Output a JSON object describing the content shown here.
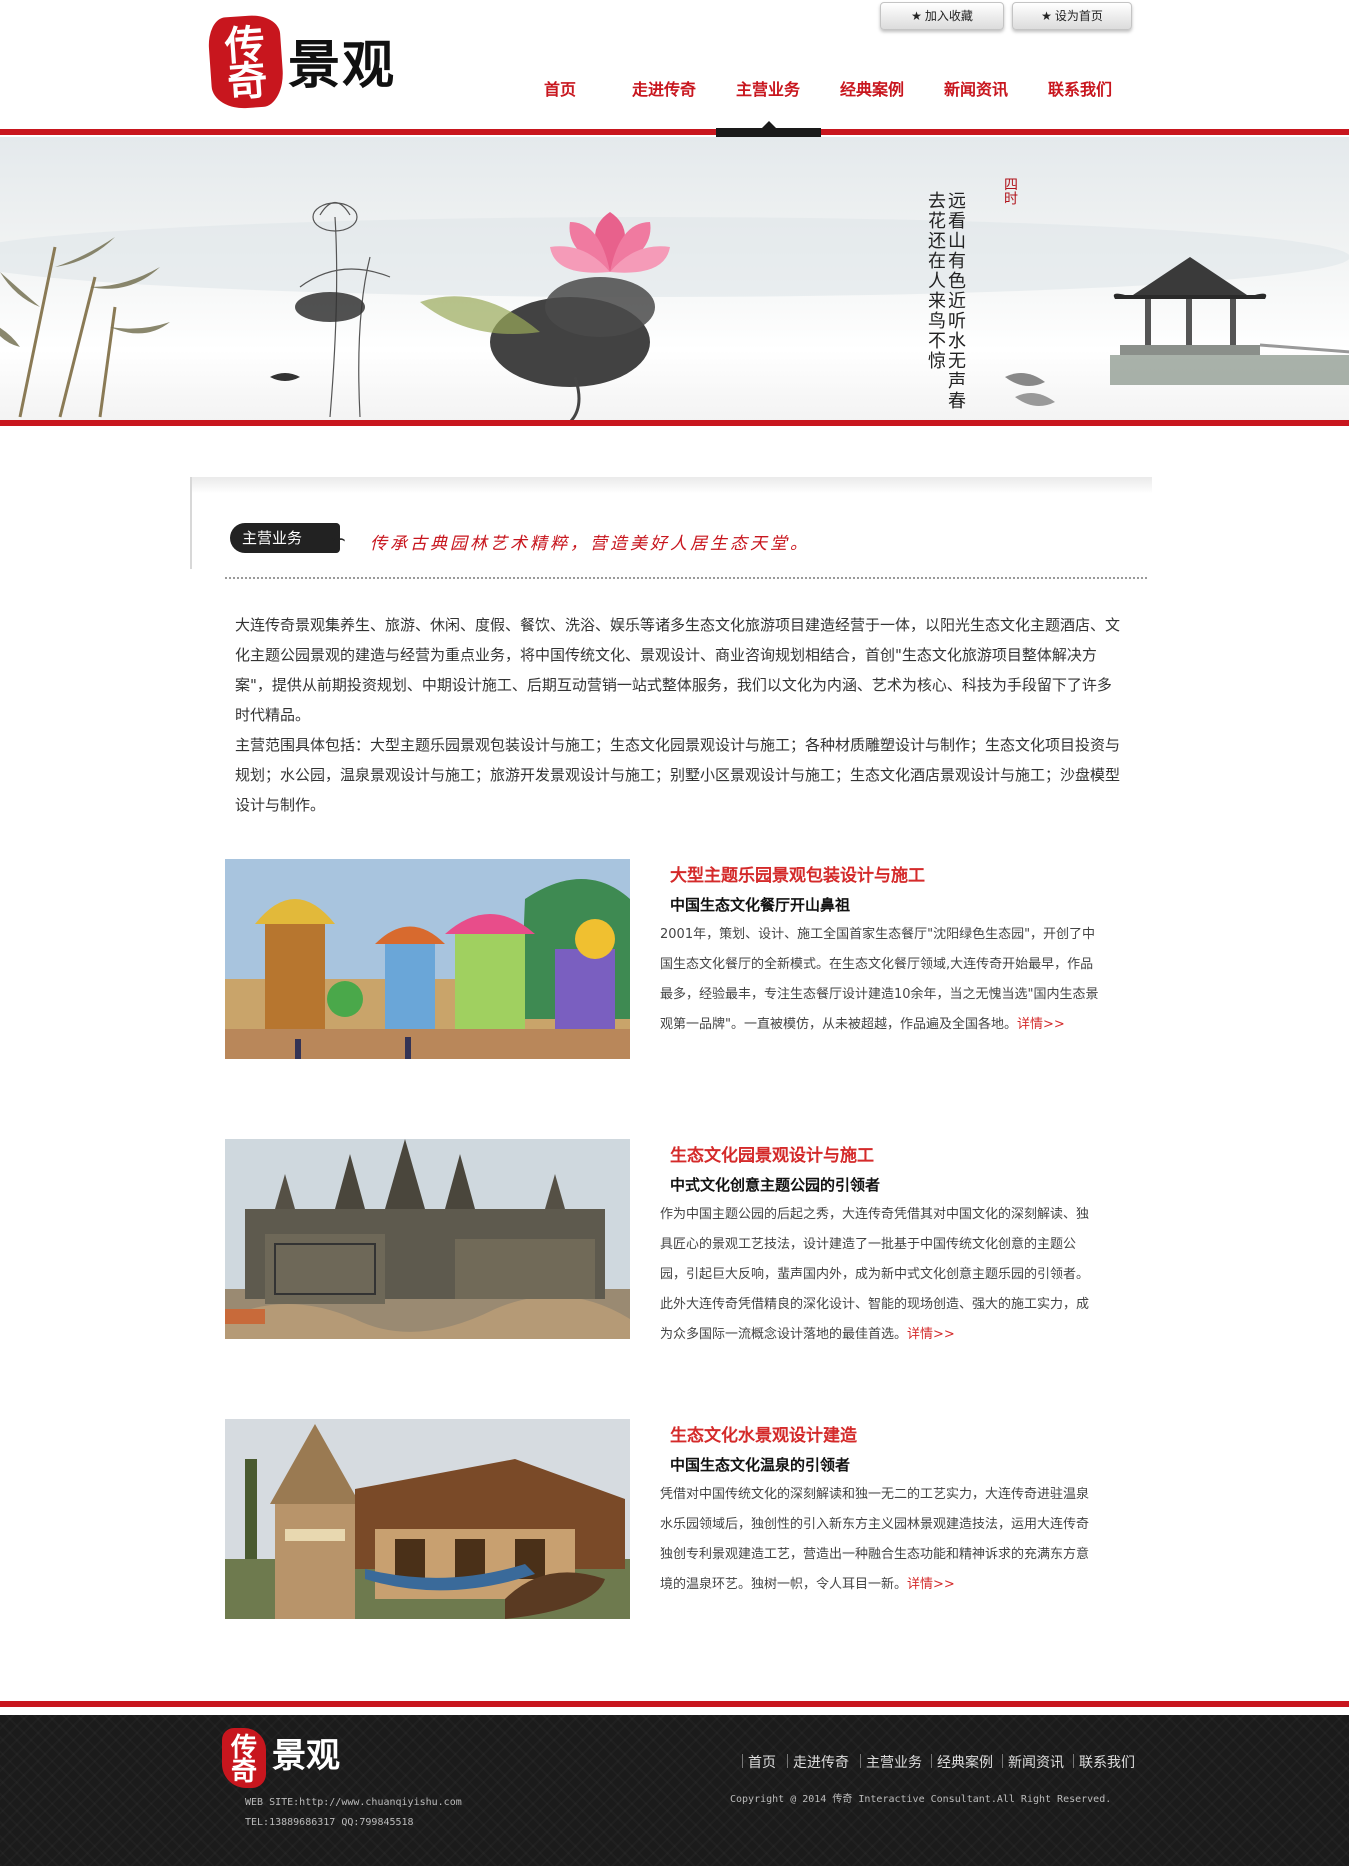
{
  "header": {
    "logo_seal": "传奇",
    "logo_text": "景观",
    "btn_favorite": "加入收藏",
    "btn_homepage": "设为首页"
  },
  "nav": {
    "items": [
      {
        "label": "首页"
      },
      {
        "label": "走进传奇"
      },
      {
        "label": "主营业务"
      },
      {
        "label": "经典案例"
      },
      {
        "label": "新闻资讯"
      },
      {
        "label": "联系我们"
      }
    ],
    "active_index": 2
  },
  "section": {
    "tab_label": "主营业务",
    "slogan": "传承古典园林艺术精粹，营造美好人居生态天堂。"
  },
  "intro": {
    "para1": "大连传奇景观集养生、旅游、休闲、度假、餐饮、洗浴、娱乐等诸多生态文化旅游项目建造经营于一体，以阳光生态文化主题酒店、文化主题公园景观的建造与经营为重点业务，将中国传统文化、景观设计、商业咨询规划相结合，首创\"生态文化旅游项目整体解决方案\"，提供从前期投资规划、中期设计施工、后期互动营销一站式整体服务，我们以文化为内涵、艺术为核心、科技为手段留下了许多时代精品。",
    "para2": "主营范围具体包括：大型主题乐园景观包装设计与施工；生态文化园景观设计与施工；各种材质雕塑设计与制作；生态文化项目投资与规划；水公园，温泉景观设计与施工；旅游开发景观设计与施工；别墅小区景观设计与施工；生态文化酒店景观设计与施工；沙盘模型设计与制作。"
  },
  "features": [
    {
      "title": "大型主题乐园景观包装设计与施工",
      "subtitle": "中国生态文化餐厅开山鼻祖",
      "text": "2001年，策划、设计、施工全国首家生态餐厅\"沈阳绿色生态园\"，开创了中国生态文化餐厅的全新模式。在生态文化餐厅领域,大连传奇开始最早，作品最多，经验最丰，专注生态餐厅设计建造10余年，当之无愧当选\"国内生态景观第一品牌\"。一直被模仿，从未被超越，作品遍及全国各地。",
      "more": "详情>>"
    },
    {
      "title": "生态文化园景观设计与施工",
      "subtitle": "中式文化创意主题公园的引领者",
      "text": "作为中国主题公园的后起之秀，大连传奇凭借其对中国文化的深刻解读、独具匠心的景观工艺技法，设计建造了一批基于中国传统文化创意的主题公园，引起巨大反响，蜚声国内外，成为新中式文化创意主题乐园的引领者。此外大连传奇凭借精良的深化设计、智能的现场创造、强大的施工实力，成为众多国际一流概念设计落地的最佳首选。",
      "more": "详情>>"
    },
    {
      "title": "生态文化水景观设计建造",
      "subtitle": "中国生态文化温泉的引领者",
      "text": "凭借对中国传统文化的深刻解读和独一无二的工艺实力，大连传奇进驻温泉水乐园领域后，独创性的引入新东方主义园林景观建造技法，运用大连传奇独创专利景观建造工艺，营造出一种融合生态功能和精神诉求的充满东方意境的温泉环艺。独树一帜，令人耳目一新。",
      "more": "详情>>"
    }
  ],
  "footer": {
    "logo_seal": "传奇",
    "logo_text": "景观",
    "website": "WEB SITE:http://www.chuanqiyishu.com",
    "tel": "TEL:13889686317 QQ:799845518",
    "nav": [
      "首页",
      "走进传奇",
      "主营业务",
      "经典案例",
      "新闻资讯",
      "联系我们"
    ],
    "copyright": "Copyright @ 2014 传奇 Interactive Consultant.All Right Reserved."
  },
  "colors": {
    "brand_red": "#c8161e",
    "link_red": "#d42a2a",
    "footer_bg": "#1b1b1b"
  },
  "icons": {
    "favorite": "star-icon",
    "homepage": "star-icon"
  }
}
